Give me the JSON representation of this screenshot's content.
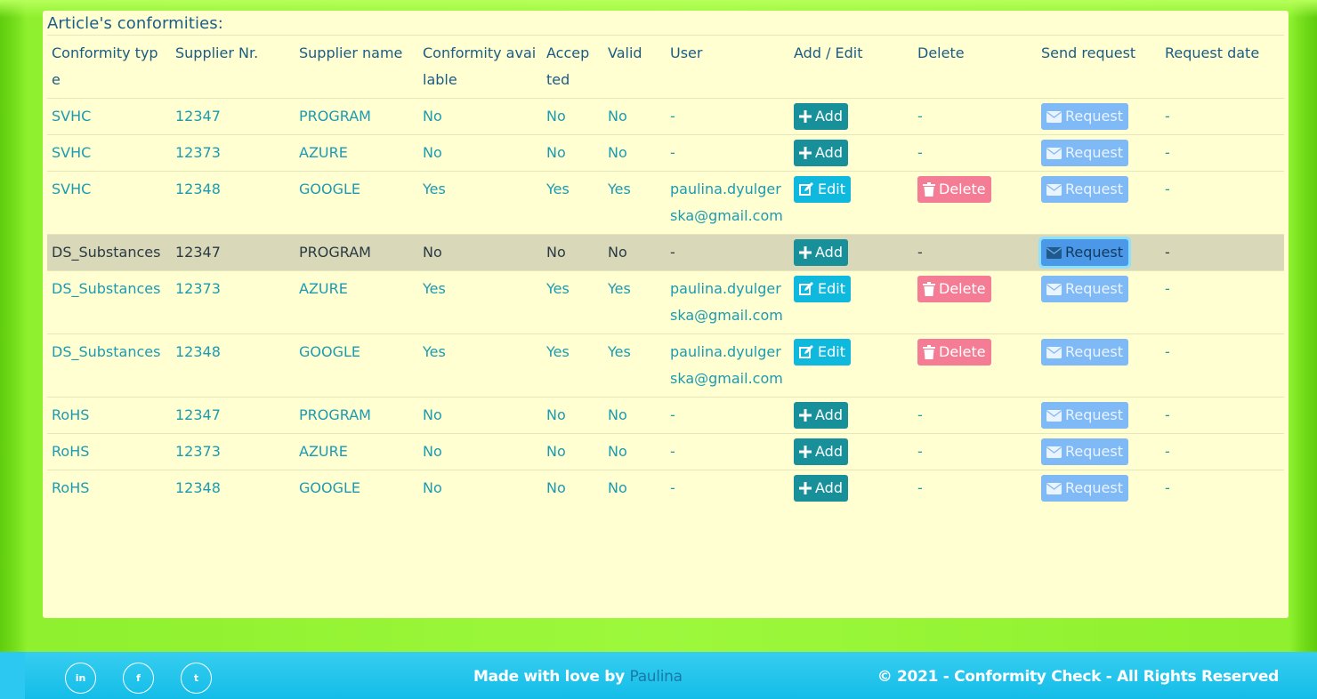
{
  "section_title": "Article's conformities:",
  "columns": [
    "Conformity type",
    "Supplier Nr.",
    "Supplier name",
    "Conformity available",
    "Accep ted",
    "Valid",
    "User",
    "Add / Edit",
    "Delete",
    "Send request",
    "Request date"
  ],
  "rows": [
    {
      "type": "SVHC",
      "supplier_nr": "12347",
      "supplier_name": "PROGRAM",
      "available": "No",
      "accepted": "No",
      "valid": "No",
      "user": "-",
      "action": "Add",
      "delete": "-",
      "request": "Request",
      "request_date": "-"
    },
    {
      "type": "SVHC",
      "supplier_nr": "12373",
      "supplier_name": "AZURE",
      "available": "No",
      "accepted": "No",
      "valid": "No",
      "user": "-",
      "action": "Add",
      "delete": "-",
      "request": "Request",
      "request_date": "-"
    },
    {
      "type": "SVHC",
      "supplier_nr": "12348",
      "supplier_name": "GOOGLE",
      "available": "Yes",
      "accepted": "Yes",
      "valid": "Yes",
      "user": "paulina.dyulgerska@gmail.com",
      "action": "Edit",
      "delete": "Delete",
      "request": "Request",
      "request_date": "-"
    },
    {
      "type": "DS_Substances",
      "supplier_nr": "12347",
      "supplier_name": "PROGRAM",
      "available": "No",
      "accepted": "No",
      "valid": "No",
      "user": "-",
      "action": "Add",
      "delete": "-",
      "request": "Request",
      "request_date": "-"
    },
    {
      "type": "DS_Substances",
      "supplier_nr": "12373",
      "supplier_name": "AZURE",
      "available": "Yes",
      "accepted": "Yes",
      "valid": "Yes",
      "user": "paulina.dyulgerska@gmail.com",
      "action": "Edit",
      "delete": "Delete",
      "request": "Request",
      "request_date": "-"
    },
    {
      "type": "DS_Substances",
      "supplier_nr": "12348",
      "supplier_name": "GOOGLE",
      "available": "Yes",
      "accepted": "Yes",
      "valid": "Yes",
      "user": "paulina.dyulgerska@gmail.com",
      "action": "Edit",
      "delete": "Delete",
      "request": "Request",
      "request_date": "-"
    },
    {
      "type": "RoHS",
      "supplier_nr": "12347",
      "supplier_name": "PROGRAM",
      "available": "No",
      "accepted": "No",
      "valid": "No",
      "user": "-",
      "action": "Add",
      "delete": "-",
      "request": "Request",
      "request_date": "-"
    },
    {
      "type": "RoHS",
      "supplier_nr": "12373",
      "supplier_name": "AZURE",
      "available": "No",
      "accepted": "No",
      "valid": "No",
      "user": "-",
      "action": "Add",
      "delete": "-",
      "request": "Request",
      "request_date": "-"
    },
    {
      "type": "RoHS",
      "supplier_nr": "12348",
      "supplier_name": "GOOGLE",
      "available": "No",
      "accepted": "No",
      "valid": "No",
      "user": "-",
      "action": "Add",
      "delete": "-",
      "request": "Request",
      "request_date": "-"
    }
  ],
  "hovered_row": 3,
  "footer": {
    "social": [
      {
        "name": "linkedin-icon",
        "glyph": "in"
      },
      {
        "name": "facebook-icon",
        "glyph": "f"
      },
      {
        "name": "twitter-icon",
        "glyph": "t"
      }
    ],
    "made_with": "Made with love by",
    "author": "Paulina",
    "copyright": "© 2021 - Conformity Check - All Rights Reserved"
  },
  "colors": {
    "background": "#9df83c",
    "card": "#ffffd1",
    "header_text": "#1a5c86",
    "cell_text": "#1b9bb3",
    "add_button": "#17909a",
    "edit_button": "#0fb9dd",
    "delete_button": "#f47c95",
    "request_button": "#7fb9f6",
    "footer": "#14bde8"
  }
}
